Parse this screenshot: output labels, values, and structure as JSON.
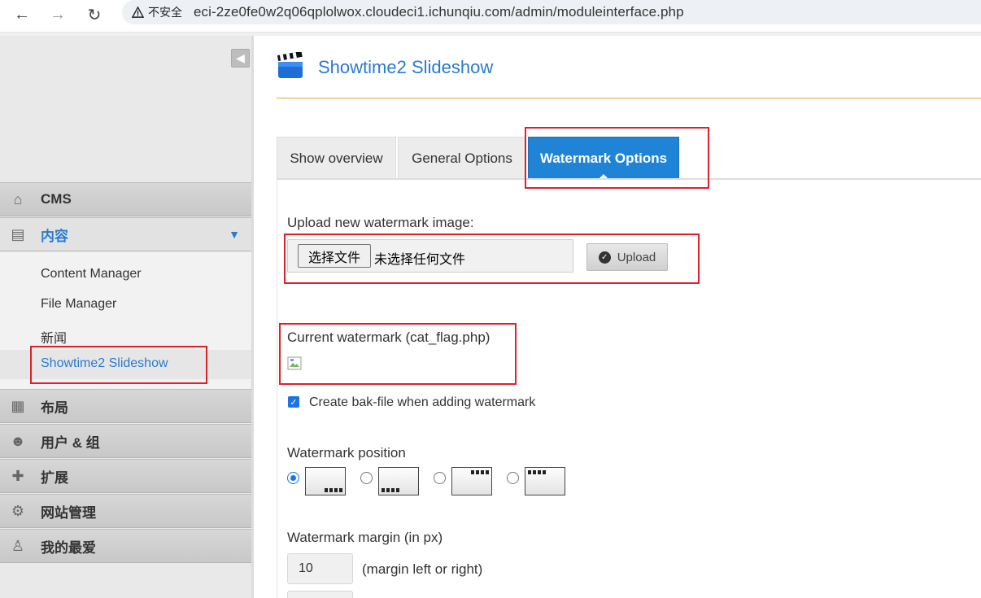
{
  "browser": {
    "back_icon": "arrow-left-icon",
    "forward_icon": "arrow-right-icon",
    "reload_icon": "reload-icon",
    "security_label": "不安全",
    "url": "eci-2ze0fe0w2q06qplolwox.cloudeci1.ichunqiu.com/admin/moduleinterface.php"
  },
  "sidebar": {
    "collapse_icon": "chevron-left-icon",
    "sections": [
      {
        "label": "CMS",
        "icon": "home-icon"
      },
      {
        "label": "内容",
        "icon": "content-icon",
        "expanded": true
      },
      {
        "label": "布局",
        "icon": "layout-icon"
      },
      {
        "label": "用户 & 组",
        "icon": "users-icon"
      },
      {
        "label": "扩展",
        "icon": "puzzle-icon"
      },
      {
        "label": "网站管理",
        "icon": "gear-icon"
      },
      {
        "label": "我的最爱",
        "icon": "user-icon"
      }
    ],
    "content_items": [
      "Content Manager",
      "File Manager",
      "新闻",
      "Showtime2 Slideshow"
    ],
    "active_item": "Showtime2 Slideshow"
  },
  "page": {
    "title": "Showtime2 Slideshow",
    "title_icon": "clapperboard-icon"
  },
  "tabs": [
    {
      "label": "Show overview"
    },
    {
      "label": "General Options"
    },
    {
      "label": "Watermark Options",
      "active": true
    }
  ],
  "watermark": {
    "upload_label": "Upload new watermark image:",
    "file_button": "选择文件",
    "file_status": "未选择任何文件",
    "upload_button": "Upload",
    "current_label": "Current watermark (cat_flag.php)",
    "bak_checkbox_label": "Create bak-file when adding watermark",
    "bak_checked": true,
    "position_label": "Watermark position",
    "positions": [
      "bottom-right",
      "bottom-left",
      "top-right",
      "top-left"
    ],
    "selected_position": "bottom-right",
    "margin_label": "Watermark margin (in px)",
    "margin_value": "10",
    "margin_hint": "(margin left or right)"
  },
  "colors": {
    "accent": "#1f84d6",
    "link": "#2a7ad0",
    "rule": "#f0a31c",
    "highlight": "#e0202a"
  }
}
